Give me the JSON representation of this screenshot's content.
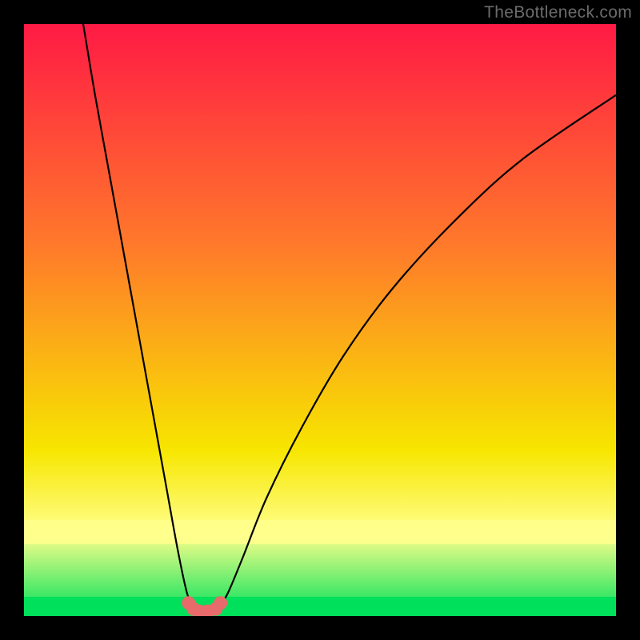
{
  "watermark": "TheBottleneck.com",
  "chart_data": {
    "type": "line",
    "title": "",
    "xlabel": "",
    "ylabel": "",
    "xlim": [
      0,
      100
    ],
    "ylim": [
      0,
      100
    ],
    "grid": false,
    "legend": null,
    "background_gradient": {
      "top": "#ff1a45",
      "mid1": "#ff7b2a",
      "mid2": "#f7e600",
      "band": "#ffff8c",
      "bottom": "#00e05a"
    },
    "series": [
      {
        "name": "curve-left",
        "x": [
          10,
          12,
          14,
          16,
          18,
          20,
          22,
          24,
          26,
          27.5,
          28.5
        ],
        "y": [
          100,
          88,
          77,
          66,
          55,
          44,
          33,
          22,
          11,
          4,
          1.5
        ]
      },
      {
        "name": "curve-right",
        "x": [
          33,
          34.5,
          37,
          41,
          47,
          54,
          62,
          72,
          84,
          100
        ],
        "y": [
          1.5,
          4,
          10,
          20,
          32,
          44,
          55,
          66,
          77,
          88
        ]
      },
      {
        "name": "valley-markers",
        "x": [
          27.8,
          28.6,
          29.6,
          31.0,
          32.4,
          33.2
        ],
        "y": [
          2.2,
          1.2,
          0.8,
          0.8,
          1.2,
          2.2
        ]
      }
    ],
    "annotations": []
  }
}
